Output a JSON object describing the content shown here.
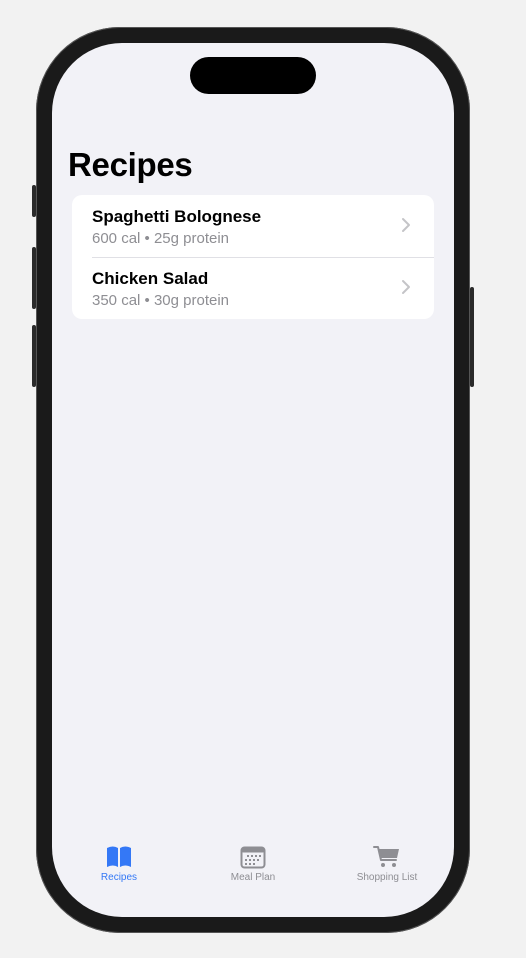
{
  "app": {
    "title": "Recipes"
  },
  "recipes": [
    {
      "name": "Spaghetti Bolognese",
      "details": "600 cal • 25g protein"
    },
    {
      "name": "Chicken Salad",
      "details": "350 cal • 30g protein"
    }
  ],
  "tabs": [
    {
      "label": "Recipes",
      "icon": "book-icon",
      "active": true
    },
    {
      "label": "Meal Plan",
      "icon": "calendar-icon",
      "active": false
    },
    {
      "label": "Shopping List",
      "icon": "cart-icon",
      "active": false
    }
  ],
  "colors": {
    "accent": "#3478f6",
    "inactive": "#8e8e93",
    "background": "#f2f2f7"
  }
}
